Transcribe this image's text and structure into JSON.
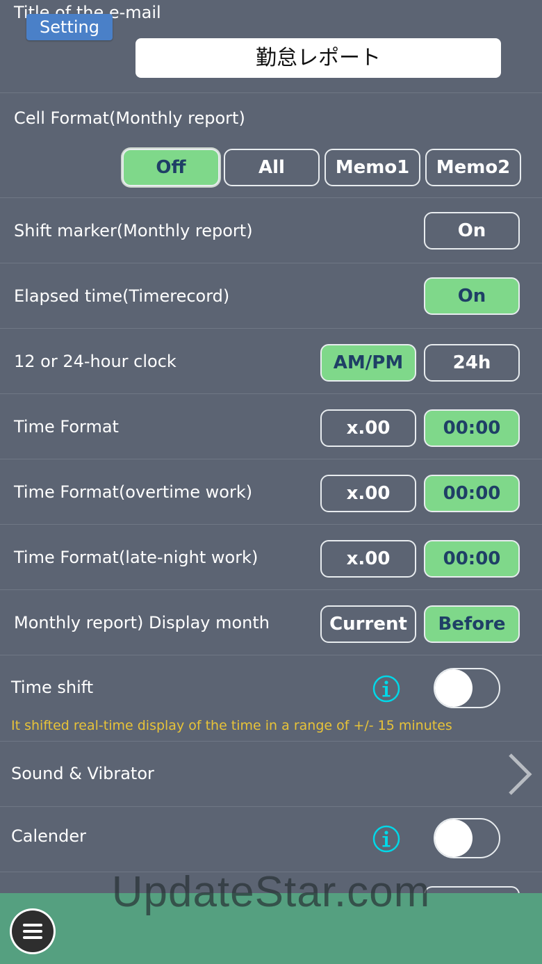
{
  "email_title": {
    "label": "Title of the e-mail",
    "setting_badge": "Setting",
    "value": "勤怠レポート"
  },
  "cell_format": {
    "label": "Cell Format(Monthly report)",
    "options": [
      {
        "label": "Off",
        "selected": true
      },
      {
        "label": "All",
        "selected": false
      },
      {
        "label": "Memo1",
        "selected": false
      },
      {
        "label": "Memo2",
        "selected": false
      }
    ]
  },
  "shift_marker": {
    "label": "Shift marker(Monthly report)",
    "button": "On",
    "selected": false
  },
  "elapsed_time": {
    "label": "Elapsed time(Timerecord)",
    "button": "On",
    "selected": true
  },
  "clock": {
    "label": "12 or 24-hour clock",
    "options": [
      {
        "label": "AM/PM",
        "selected": true
      },
      {
        "label": "24h",
        "selected": false
      }
    ]
  },
  "time_format": {
    "label": "Time Format",
    "options": [
      {
        "label": "x.00",
        "selected": false
      },
      {
        "label": "00:00",
        "selected": true
      }
    ]
  },
  "time_format_overtime": {
    "label": "Time Format(overtime work)",
    "options": [
      {
        "label": "x.00",
        "selected": false
      },
      {
        "label": "00:00",
        "selected": true
      }
    ]
  },
  "time_format_late_night": {
    "label": "Time Format(late-night work)",
    "options": [
      {
        "label": "x.00",
        "selected": false
      },
      {
        "label": "00:00",
        "selected": true
      }
    ]
  },
  "display_month": {
    "label": "Monthly report) Display month",
    "options": [
      {
        "label": "Current",
        "selected": false
      },
      {
        "label": "Before",
        "selected": true
      }
    ]
  },
  "time_shift": {
    "label": "Time shift",
    "description": "It shifted real-time display of the time in a range of +/- 15 minutes",
    "enabled": false
  },
  "sound_vibrator": {
    "label": "Sound & Vibrator"
  },
  "calender": {
    "label": "Calender",
    "enabled": false
  },
  "watermark": "UpdateStar.com",
  "colors": {
    "background": "#5c6473",
    "selected_fill": "#7fd88a",
    "selected_text": "#1f3f66",
    "border": "#e8ecef",
    "info_cyan": "#00d8e8",
    "description_yellow": "#e8c338",
    "bottom_bar": "#55a080",
    "setting_badge": "#4a80c8"
  },
  "icons": {
    "info": "info-icon",
    "chevron": "chevron-right-icon",
    "menu": "hamburger-menu-icon"
  }
}
